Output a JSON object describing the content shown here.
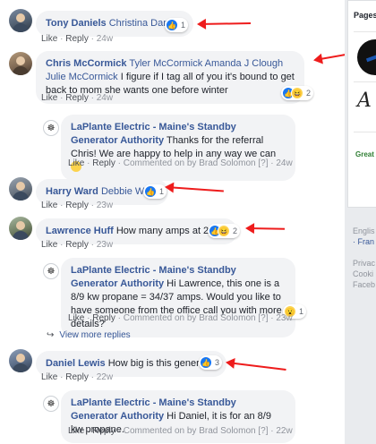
{
  "comments": [
    {
      "name": "Tony Daniels",
      "text": "Christina Daniels",
      "reactions": {
        "count": "1"
      },
      "meta": {
        "like": "Like",
        "reply": "Reply",
        "time": "24w"
      }
    },
    {
      "name": "Chris McCormick",
      "tags": "Tyler McCormick Amanda J Clough Julie McCormick",
      "text": "I figure if I tag all of you it's bound to get back to mom she wants one before winter",
      "reactions": {
        "count": "2"
      },
      "meta": {
        "like": "Like",
        "reply": "Reply",
        "time": "24w"
      },
      "reply": {
        "name": "LaPlante Electric - Maine's Standby Generator Authority",
        "text": "Thanks for the referral Chris! We are happy to help in any way we can",
        "meta": {
          "like": "Like",
          "reply": "Reply",
          "commented_on": "Commented on by Brad Solomon",
          "help": "[?]",
          "time": "24w"
        }
      }
    },
    {
      "name": "Harry Ward",
      "text": "Debbie Ward",
      "reactions": {
        "count": "1"
      },
      "meta": {
        "like": "Like",
        "reply": "Reply",
        "time": "23w"
      }
    },
    {
      "name": "Lawrence Huff",
      "text": "How many amps at 220 v",
      "reactions": {
        "count": "2"
      },
      "meta": {
        "like": "Like",
        "reply": "Reply",
        "time": "23w"
      },
      "reply": {
        "name": "LaPlante Electric - Maine's Standby Generator Authority",
        "text": "Hi Lawrence, this one is a 8/9 kw propane = 34/37 amps. Would you like to have someone from the office call you with more details?",
        "reactions": {
          "count": "1"
        },
        "meta": {
          "like": "Like",
          "reply": "Reply",
          "commented_on": "Commented on by Brad Solomon",
          "help": "[?]",
          "time": "23w"
        }
      },
      "more_replies": "View more replies"
    },
    {
      "name": "Daniel Lewis",
      "text": "How big is this generator",
      "reactions": {
        "count": "3"
      },
      "meta": {
        "like": "Like",
        "reply": "Reply",
        "time": "22w"
      },
      "reply": {
        "name": "LaPlante Electric - Maine's Standby Generator Authority",
        "text": "Hi Daniel, it is for an 8/9 kw propane.",
        "meta": {
          "like": "Like",
          "reply": "Reply",
          "commented_on": "Commented on by Brad Solomon",
          "help": "[?]",
          "time": "22w"
        }
      }
    }
  ],
  "sidebar": {
    "title": "Pages",
    "footer_lang": "Englis",
    "footer_lang2": "· Fran",
    "footer_privacy": "Privac",
    "footer_cookies": "Cooki",
    "footer_facebook": "Faceb"
  },
  "colors": {
    "annotation_arrow": "#ee1c1c",
    "link": "#385898",
    "like_blue": "#1877f2"
  }
}
